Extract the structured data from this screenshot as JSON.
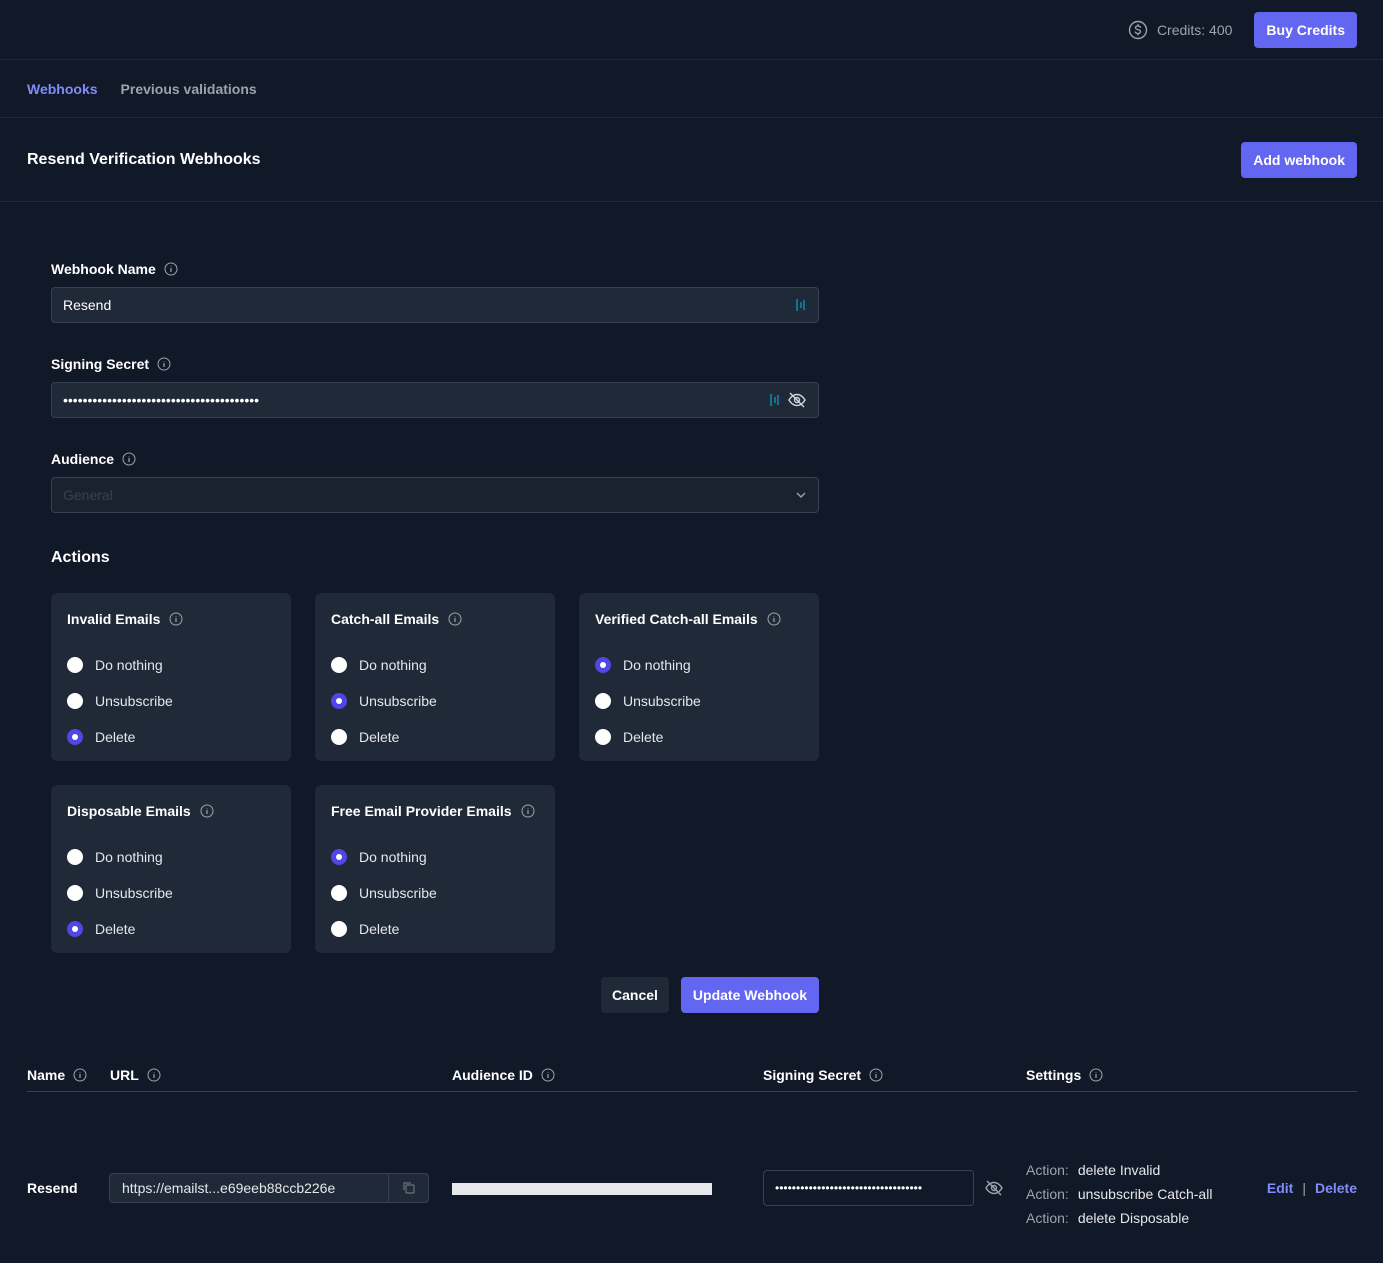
{
  "header": {
    "credits_label": "Credits: 400",
    "buy_credits_label": "Buy Credits"
  },
  "tabs": [
    {
      "label": "Webhooks",
      "active": true
    },
    {
      "label": "Previous validations",
      "active": false
    }
  ],
  "section": {
    "title": "Resend Verification Webhooks",
    "add_button": "Add webhook"
  },
  "form": {
    "name_label": "Webhook Name",
    "name_value": "Resend",
    "secret_label": "Signing Secret",
    "secret_value": "••••••••••••••••••••••••••••••••••••••••",
    "audience_label": "Audience",
    "audience_placeholder": "General",
    "actions_title": "Actions",
    "cancel_label": "Cancel",
    "update_label": "Update Webhook"
  },
  "action_cards": [
    {
      "title": "Invalid Emails",
      "options": [
        "Do nothing",
        "Unsubscribe",
        "Delete"
      ],
      "selected": "Delete"
    },
    {
      "title": "Catch-all Emails",
      "options": [
        "Do nothing",
        "Unsubscribe",
        "Delete"
      ],
      "selected": "Unsubscribe"
    },
    {
      "title": "Verified Catch-all Emails",
      "options": [
        "Do nothing",
        "Unsubscribe",
        "Delete"
      ],
      "selected": "Do nothing"
    },
    {
      "title": "Disposable Emails",
      "options": [
        "Do nothing",
        "Unsubscribe",
        "Delete"
      ],
      "selected": "Delete"
    },
    {
      "title": "Free Email Provider Emails",
      "options": [
        "Do nothing",
        "Unsubscribe",
        "Delete"
      ],
      "selected": "Do nothing"
    }
  ],
  "table": {
    "headers": {
      "name": "Name",
      "url": "URL",
      "audience": "Audience ID",
      "secret": "Signing Secret",
      "settings": "Settings"
    },
    "rows": [
      {
        "name": "Resend",
        "url": "https://emailst...e69eeb88ccb226e",
        "secret": "•••••••••••••••••••••••••••••••••••",
        "settings": [
          {
            "key": "Action:",
            "value": "delete Invalid"
          },
          {
            "key": "Action:",
            "value": "unsubscribe Catch-all"
          },
          {
            "key": "Action:",
            "value": "delete Disposable"
          }
        ],
        "edit": "Edit",
        "separator": "|",
        "delete": "Delete"
      }
    ]
  },
  "colors": {
    "background": "#111827",
    "accent": "#6366f1",
    "link": "#818cf8"
  },
  "icons": [
    "dollar-circle-icon",
    "info-icon",
    "password-manager-icon",
    "eye-off-icon",
    "chevron-down-icon",
    "copy-icon"
  ]
}
